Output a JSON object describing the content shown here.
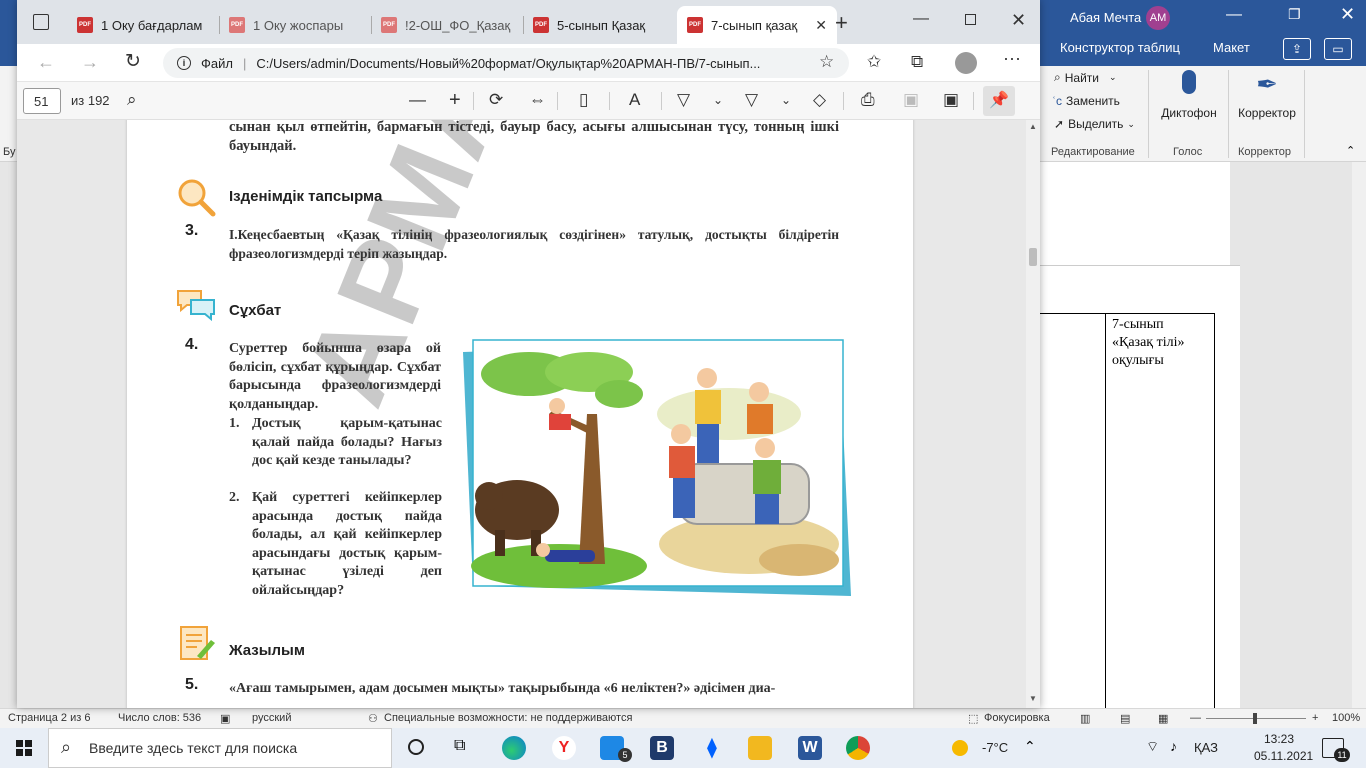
{
  "word": {
    "tabs": [
      "Конструктор таблиц",
      "Макет"
    ],
    "user": "Абая Мечта",
    "initials": "АМ",
    "edit": {
      "find": "Найти",
      "replace": "Заменить",
      "select": "Выделить"
    },
    "groups": [
      "Редактирование",
      "Голос",
      "Корректор"
    ],
    "dictation": "Диктофон",
    "editor": "Корректор",
    "cell_text": "7-сынып «Қазақ тілі» оқулығы",
    "left_letters": [
      "Бу"
    ],
    "status": {
      "page": "Страница 2 из 6",
      "words": "Число слов: 536",
      "lang": "русский",
      "access": "Специальные возможности: не поддерживаются",
      "focus": "Фокусировка",
      "zoom": "100%"
    }
  },
  "taskbar": {
    "search_placeholder": "Введите здесь текст для поиска",
    "weather": "-7°C",
    "lang": "ҚАЗ",
    "time": "13:23",
    "date": "05.11.2021",
    "notif": "11",
    "mail_badge": "5"
  },
  "edge": {
    "tabs": [
      {
        "label": "1 Оку бағдарлам",
        "active": false
      },
      {
        "label": "1 Оку жоспары",
        "active": false
      },
      {
        "label": "!2-ОШ_ФО_Қазақ",
        "active": false
      },
      {
        "label": "5-сынып Қазақ",
        "active": false
      },
      {
        "label": "7-сынып қазақ",
        "active": true
      }
    ],
    "file_label": "Файл",
    "url": "C:/Users/admin/Documents/Новый%20формат/Оқулықтар%20АРМАН-ПВ/7-сынып...",
    "page_num": "51",
    "page_total": "из 192"
  },
  "pdf": {
    "top_text": "сынан қыл өтпейтін, бармағын тістеді, бауыр басу, асығы алшысынан түсу, тонның ішкі бауындай.",
    "sec1_title": "Ізденімдік тапсырма",
    "t3_num": "3.",
    "t3_text": "І.Кеңесбаевтың «Қазақ тілінің фразеологиялық сөздігінен» татулық, достықты білдіретін фразеологизмдерді теріп жазыңдар.",
    "sec2_title": "Сұхбат",
    "t4_num": "4.",
    "t4_text": "Суреттер бойынша өзара ой бөлісіп, сұхбат құрыңдар. Сұхбат барысында фразеологизмдерді қолданыңдар.",
    "q1_num": "1.",
    "q1": "Достық қарым-қатынас қалай пайда болады? Нағыз дос қай кезде танылады?",
    "q2_num": "2.",
    "q2": "Қай суреттегі кейіпкерлер арасында достық пайда болады, ал қай кейіпкерлер арасындағы достық қарым-қатынас үзіледі деп ойлайсыңдар?",
    "sec3_title": "Жазылым",
    "t5_num": "5.",
    "t5_text": "«Ағаш тамырымен, адам досымен мықты» тақырыбында «6 неліктен?» әдісімен диа-",
    "watermark": "АРМАН-ПВ баспасы"
  }
}
